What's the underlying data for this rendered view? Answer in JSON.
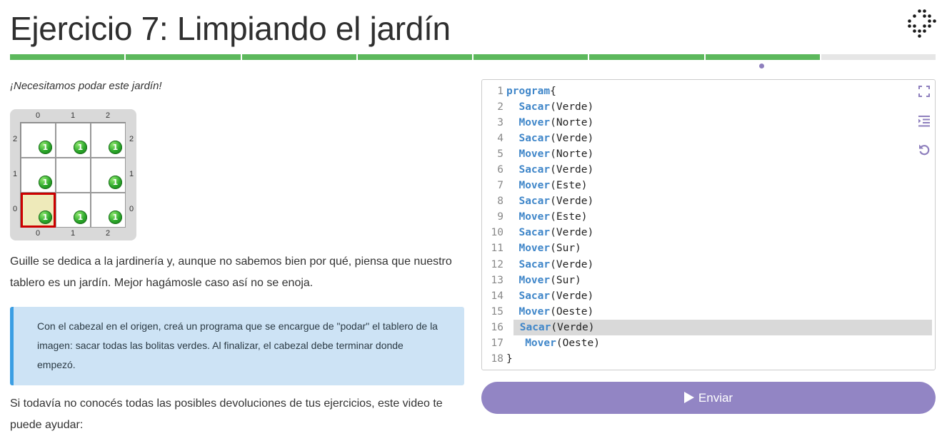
{
  "page": {
    "title": "Ejercicio 7: Limpiando el jardín"
  },
  "progress": {
    "segments_total": 8,
    "segments_completed": 7,
    "current_index": 7
  },
  "intro": "¡Necesitamos podar este jardín!",
  "board": {
    "columns": [
      "0",
      "1",
      "2"
    ],
    "rows_top_to_bottom": [
      "2",
      "1",
      "0"
    ],
    "cells": [
      [
        {
          "ball": "1"
        },
        {
          "ball": "1"
        },
        {
          "ball": "1"
        }
      ],
      [
        {
          "ball": "1"
        },
        {
          "ball": ""
        },
        {
          "ball": "1"
        }
      ],
      [
        {
          "ball": "1",
          "head": true
        },
        {
          "ball": "1"
        },
        {
          "ball": "1"
        }
      ]
    ],
    "ball_color": "#28a428",
    "head_border_color": "#cc0000"
  },
  "paragraph1": "Guille se dedica a la jardinería y, aunque no sabemos bien por qué, piensa que nuestro tablero es un jardín. Mejor hagámosle caso así no se enoja.",
  "note": "Con el cabezal en el origen, creá un programa que se encargue de \"podar\" el tablero de la imagen: sacar todas las bolitas verdes. Al finalizar, el cabezal debe terminar donde empezó.",
  "paragraph2": "Si todavía no conocés todas las posibles devoluciones de tus ejercicios, este video te puede ayudar:",
  "editor": {
    "lines": [
      {
        "n": "1",
        "kw": "program",
        "rest": "{",
        "indent": ""
      },
      {
        "n": "2",
        "kw": "Sacar",
        "rest": "(Verde)",
        "indent": "  "
      },
      {
        "n": "3",
        "kw": "Mover",
        "rest": "(Norte)",
        "indent": "  "
      },
      {
        "n": "4",
        "kw": "Sacar",
        "rest": "(Verde)",
        "indent": "  "
      },
      {
        "n": "5",
        "kw": "Mover",
        "rest": "(Norte)",
        "indent": "  "
      },
      {
        "n": "6",
        "kw": "Sacar",
        "rest": "(Verde)",
        "indent": "  "
      },
      {
        "n": "7",
        "kw": "Mover",
        "rest": "(Este)",
        "indent": "  "
      },
      {
        "n": "8",
        "kw": "Sacar",
        "rest": "(Verde)",
        "indent": "  "
      },
      {
        "n": "9",
        "kw": "Mover",
        "rest": "(Este)",
        "indent": "  "
      },
      {
        "n": "10",
        "kw": "Sacar",
        "rest": "(Verde)",
        "indent": "  "
      },
      {
        "n": "11",
        "kw": "Mover",
        "rest": "(Sur)",
        "indent": "  "
      },
      {
        "n": "12",
        "kw": "Sacar",
        "rest": "(Verde)",
        "indent": "  "
      },
      {
        "n": "13",
        "kw": "Mover",
        "rest": "(Sur)",
        "indent": "  "
      },
      {
        "n": "14",
        "kw": "Sacar",
        "rest": "(Verde)",
        "indent": "  "
      },
      {
        "n": "15",
        "kw": "Mover",
        "rest": "(Oeste)",
        "indent": "  "
      },
      {
        "n": "16",
        "kw": "Sacar",
        "rest": "(Verde)",
        "indent": "  ",
        "selected": true
      },
      {
        "n": "17",
        "kw": "Mover",
        "rest": "(Oeste)",
        "indent": "  ",
        "selected": true
      },
      {
        "n": "18",
        "kw": "",
        "rest": "}",
        "indent": ""
      }
    ],
    "keyword_color": "#3f86c9",
    "icons": [
      "fullscreen-icon",
      "indent-icon",
      "undo-icon"
    ]
  },
  "submit": {
    "label": "Enviar",
    "icon": "play-icon",
    "color": "#9285c4"
  },
  "brand": {
    "logo_icon": "diamond-dots-logo"
  }
}
